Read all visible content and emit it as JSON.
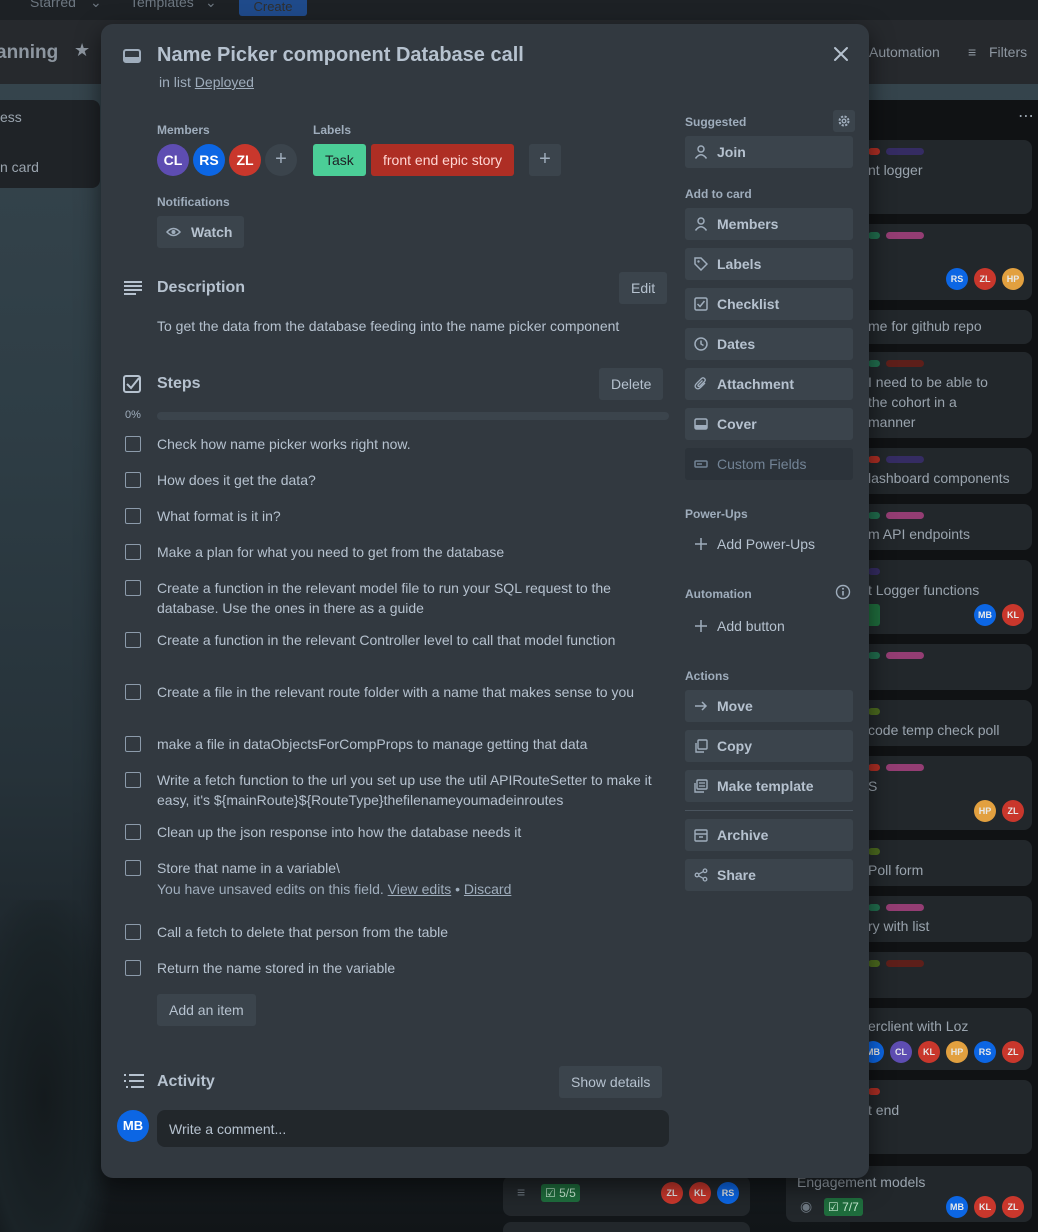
{
  "background": {
    "topbar": {
      "starred": "Starred",
      "templates": "Templates",
      "create": "Create"
    },
    "board_title": "anning",
    "header_buttons": {
      "automation": "Automation",
      "filters": "Filters"
    },
    "left_list": {
      "title": "ess",
      "add_card": "n card"
    },
    "cards": [
      {
        "text": "nt logger"
      },
      {
        "text": ""
      },
      {
        "text": "me for github repo"
      },
      {
        "text_lines": [
          "I need to be able to",
          "the cohort in a",
          "manner"
        ]
      },
      {
        "text": "lashboard components"
      },
      {
        "text": "m API endpoints"
      },
      {
        "text": "t Logger functions"
      },
      {
        "text": ""
      },
      {
        "text": "code temp check poll"
      },
      {
        "text": "S"
      },
      {
        "text": "Poll form"
      },
      {
        "text": "ry with list"
      },
      {
        "text": ""
      },
      {
        "text": "erclient with Loz"
      },
      {
        "text": "t end"
      }
    ],
    "card_avatars_1": [
      "RS",
      "ZL",
      "HP"
    ],
    "card_avatars_2": [
      "MB",
      "KL"
    ],
    "card_avatars_3": [
      "HP",
      "ZL"
    ],
    "card_avatars_4": [
      "MB",
      "CL",
      "KL",
      "HP",
      "RS",
      "ZL"
    ],
    "engagement": {
      "title": "Engagement models",
      "badge": "7/7",
      "avatars": [
        "MB",
        "KL",
        "ZL"
      ]
    },
    "mid_card": {
      "badge": "5/5",
      "avatars": [
        "ZL",
        "KL",
        "RS"
      ]
    }
  },
  "modal": {
    "title": "Name Picker component Database call",
    "in_list_prefix": "in list",
    "list_name": "Deployed",
    "members_label": "Members",
    "members": [
      {
        "initials": "CL",
        "color": "#5e4db2"
      },
      {
        "initials": "RS",
        "color": "#0c66e4"
      },
      {
        "initials": "ZL",
        "color": "#c9372c"
      }
    ],
    "labels_label": "Labels",
    "labels": [
      {
        "text": "Task",
        "color": "#4bce97",
        "text_color": "#1d2125"
      },
      {
        "text": "front end epic story",
        "color": "#ae2e24",
        "text_color": "#ffd5d2"
      }
    ],
    "notifications_label": "Notifications",
    "watch_label": "Watch",
    "description": {
      "title": "Description",
      "edit": "Edit",
      "text": "To get the data from the database feeding into the name picker component"
    },
    "checklist": {
      "title": "Steps",
      "delete": "Delete",
      "progress_text": "0%",
      "progress": 0,
      "items": [
        "Check how name picker works right now.",
        "How does it get the data?",
        "What format is it in?",
        "Make a plan for what you need to get from the database",
        "Create a function in the relevant model file to run your SQL request to the database. Use the ones in there as a guide",
        "Create a function in the relevant Controller level to call that model function",
        "Create a file in the relevant route folder with a name that makes sense to you",
        "make a file in dataObjectsForCompProps to manage getting that data",
        "Write a fetch function to the url you set up use the util APIRouteSetter to make it easy, it's ${mainRoute}${RouteType}thefilenameyoumadeinroutes",
        "Clean up the json response into how the database needs it",
        "Store that name in a variable\\",
        "Call a fetch to delete that person from the table",
        "Return the name stored in the variable"
      ],
      "unsaved_text": "You have unsaved edits on this field.",
      "view_edits": "View edits",
      "separator": "•",
      "discard": "Discard",
      "add_item": "Add an item"
    },
    "activity": {
      "title": "Activity",
      "show_details": "Show details",
      "user_initials": "MB",
      "comment_placeholder": "Write a comment..."
    },
    "sidebar": {
      "suggested_label": "Suggested",
      "join": "Join",
      "add_to_card_label": "Add to card",
      "add_to_card": [
        "Members",
        "Labels",
        "Checklist",
        "Dates",
        "Attachment",
        "Cover",
        "Custom Fields"
      ],
      "powerups_label": "Power-Ups",
      "add_powerups": "Add Power-Ups",
      "automation_label": "Automation",
      "add_button": "Add button",
      "actions_label": "Actions",
      "actions": [
        "Move",
        "Copy",
        "Make template"
      ],
      "archive": "Archive",
      "share": "Share"
    }
  }
}
